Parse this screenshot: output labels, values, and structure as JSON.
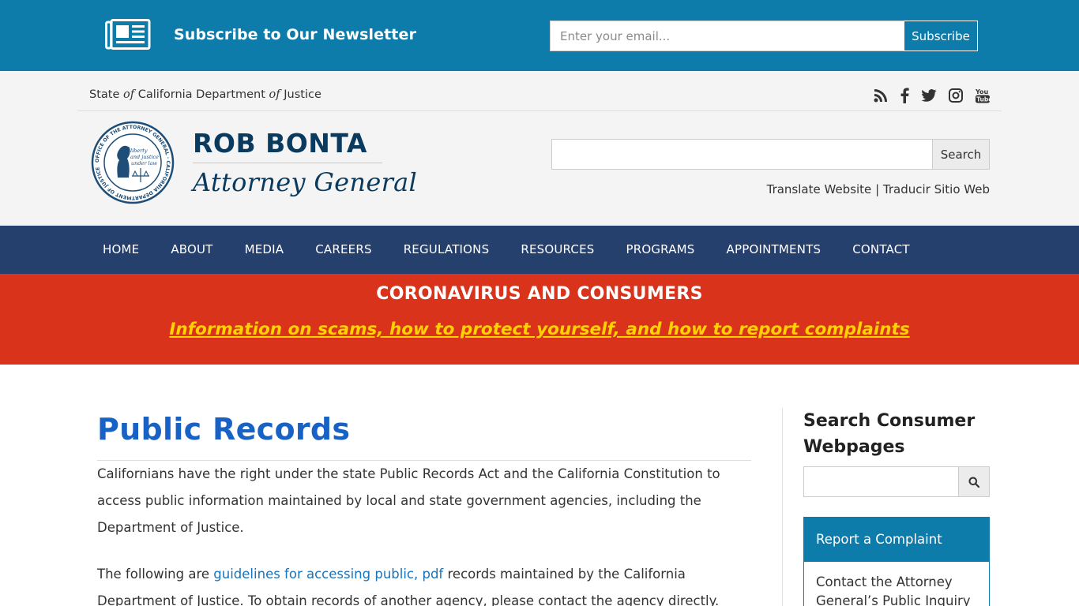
{
  "newsletter": {
    "title": "Subscribe to Our Newsletter",
    "email_placeholder": "Enter your email...",
    "subscribe_label": "Subscribe",
    "icon": "newspaper-icon"
  },
  "header": {
    "org_prefix": "State",
    "org_of1": "of",
    "org_mid": "California Department",
    "org_of2": "of",
    "org_suffix": "Justice",
    "social": [
      "rss-icon",
      "facebook-icon",
      "twitter-icon",
      "instagram-icon",
      "youtube-icon"
    ],
    "seal_icon": "attorney-general-seal",
    "seal_text": {
      "ring": "OFFICE OF THE ATTORNEY GENERAL · CALIFORNIA DEPARTMENT OF JUSTICE",
      "motto_l1": "liberty",
      "motto_l2": "and justice",
      "motto_l3": "under law"
    },
    "name": "ROB BONTA",
    "title": "Attorney General",
    "search_label": "Search",
    "translate_en": "Translate Website",
    "separator": "|",
    "translate_es": "Traducir Sitio Web"
  },
  "nav": {
    "items": [
      "HOME",
      "ABOUT",
      "MEDIA",
      "CAREERS",
      "REGULATIONS",
      "RESOURCES",
      "PROGRAMS",
      "APPOINTMENTS",
      "CONTACT"
    ]
  },
  "alert": {
    "title": "CORONAVIRUS AND CONSUMERS",
    "link": "Information on scams, how to protect yourself, and how to report complaints"
  },
  "main": {
    "title": "Public Records",
    "para1": "Californians have the right under the state Public Records Act and the California Constitution to access public information maintained by local and state government agencies, including the Department of Justice.",
    "para2_pre": "The following are ",
    "para2_link": "guidelines for accessing public, pdf",
    "para2_post": " records maintained by the California Department of Justice. To obtain records of another agency, please contact the agency directly."
  },
  "sidebar": {
    "search_title": "Search Consumer Webpages",
    "search_icon": "magnifier-icon",
    "complaint_title": "Report a Complaint",
    "complaint_text": "Contact the Attorney General’s Public Inquiry Unit"
  },
  "colors": {
    "newsletter_bg": "#0e7cab",
    "nav_bg": "#26406e",
    "alert_bg": "#d9341b",
    "alert_link": "#ffd200",
    "title_blue": "#1862c6"
  }
}
